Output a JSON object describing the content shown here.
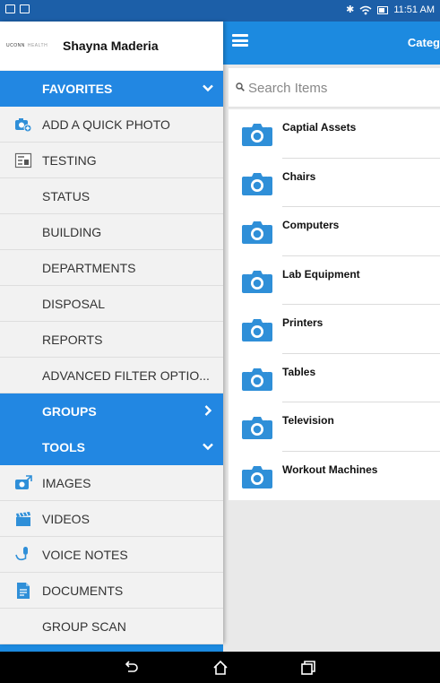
{
  "status_bar": {
    "time": "11:51 AM",
    "icons": [
      "notification-icon",
      "mail-icon",
      "bluetooth-icon",
      "wifi-icon",
      "battery-icon"
    ]
  },
  "drawer": {
    "logo_text": "UCONN",
    "logo_subtext": "HEALTH",
    "user_name": "Shayna Maderia",
    "items": [
      {
        "label": "FAVORITES",
        "type": "section",
        "chevron": "down"
      },
      {
        "label": "ADD A QUICK PHOTO",
        "type": "item",
        "icon": "camera-add-icon"
      },
      {
        "label": "TESTING",
        "type": "item",
        "icon": "testing-icon"
      },
      {
        "label": "STATUS",
        "type": "item"
      },
      {
        "label": "BUILDING",
        "type": "item"
      },
      {
        "label": "DEPARTMENTS",
        "type": "item"
      },
      {
        "label": "DISPOSAL",
        "type": "item"
      },
      {
        "label": "REPORTS",
        "type": "item"
      },
      {
        "label": "ADVANCED FILTER OPTIO...",
        "type": "item"
      },
      {
        "label": "GROUPS",
        "type": "section",
        "chevron": "right"
      },
      {
        "label": "TOOLS",
        "type": "section",
        "chevron": "down"
      },
      {
        "label": "IMAGES",
        "type": "item",
        "icon": "images-icon"
      },
      {
        "label": "VIDEOS",
        "type": "item",
        "icon": "videos-icon"
      },
      {
        "label": "VOICE NOTES",
        "type": "item",
        "icon": "microphone-icon"
      },
      {
        "label": "DOCUMENTS",
        "type": "item",
        "icon": "document-icon"
      },
      {
        "label": "GROUP SCAN",
        "type": "item"
      }
    ]
  },
  "main": {
    "title": "Categ",
    "search_placeholder": "Search Items",
    "categories": [
      "Captial Assets",
      "Chairs",
      "Computers",
      "Lab Equipment",
      "Printers",
      "Tables",
      "Television",
      "Workout Machines"
    ]
  },
  "colors": {
    "status_bar": "#1c5fa8",
    "accent": "#1c8ae0",
    "section": "#2287e2",
    "drawer_bg": "#f2f2f2",
    "camera": "#2f8fd8"
  }
}
